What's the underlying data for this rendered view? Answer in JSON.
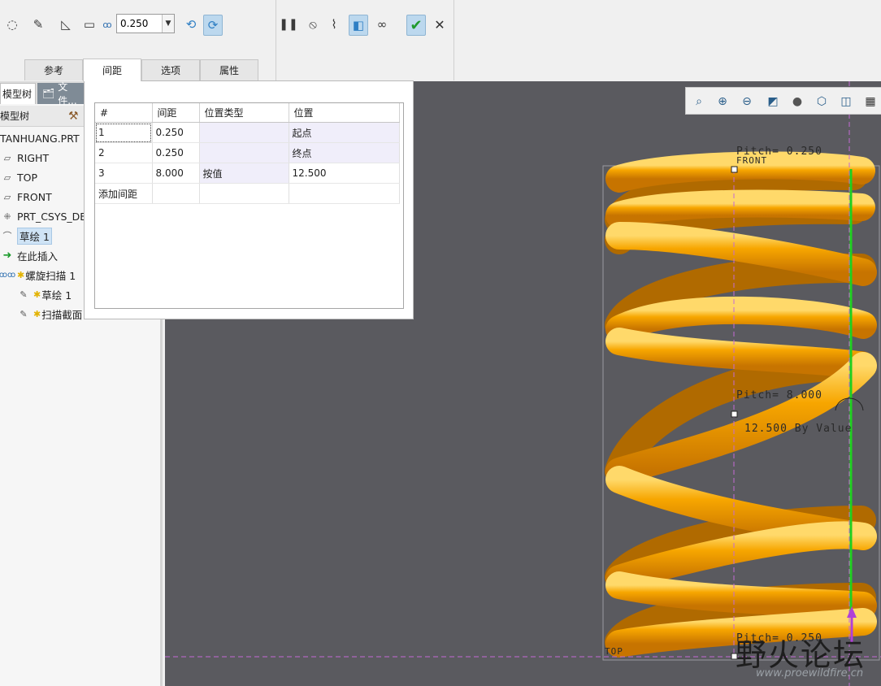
{
  "toolbar": {
    "pitch_value": "0.250",
    "icons": [
      "surface-icon",
      "sketch-edit-icon",
      "remove-material-icon",
      "thicken-icon",
      "helix-pitch-icon",
      "left-hand-icon",
      "right-hand-icon",
      "pause-icon",
      "no-preview-icon",
      "geometry-preview-icon",
      "verify-icon",
      "glasses-icon",
      "ok-icon",
      "cancel-icon"
    ]
  },
  "tabs": {
    "references": "参考",
    "pitch": "间距",
    "options": "选项",
    "properties": "属性"
  },
  "panel_tabs": {
    "model_tree": "模型树",
    "files": "文件..."
  },
  "tree": {
    "header": "模型树",
    "items": [
      {
        "label": "TANHUANG.PRT"
      },
      {
        "label": "RIGHT"
      },
      {
        "label": "TOP"
      },
      {
        "label": "FRONT"
      },
      {
        "label": "PRT_CSYS_DEF"
      },
      {
        "label": "草绘 1"
      },
      {
        "label": "在此插入"
      },
      {
        "label": "螺旋扫描 1"
      },
      {
        "label": "草绘 1"
      },
      {
        "label": "扫描截面"
      }
    ]
  },
  "pitch_table": {
    "headers": [
      "#",
      "间距",
      "位置类型",
      "位置"
    ],
    "rows": [
      {
        "num": "1",
        "pitch": "0.250",
        "type": "",
        "location": "起点"
      },
      {
        "num": "2",
        "pitch": "0.250",
        "type": "",
        "location": "终点"
      },
      {
        "num": "3",
        "pitch": "8.000",
        "type": "按值",
        "location": "12.500"
      }
    ],
    "add_label": "添加间距"
  },
  "graphics": {
    "annotations": {
      "pitch_top": "Pitch= 0.250",
      "front": "FRONT",
      "pitch_mid": "Pitch= 8.000",
      "by_value": "12.500 By Value",
      "top_plane": "TOP",
      "pitch_bottom": "Pitch= 0.250"
    },
    "spring_color": "#f5a100",
    "axis_color": "#1fd01f",
    "background": "#5a5a5f"
  },
  "watermark": {
    "text": "野火论坛",
    "url": "www.proewildfire.cn"
  }
}
